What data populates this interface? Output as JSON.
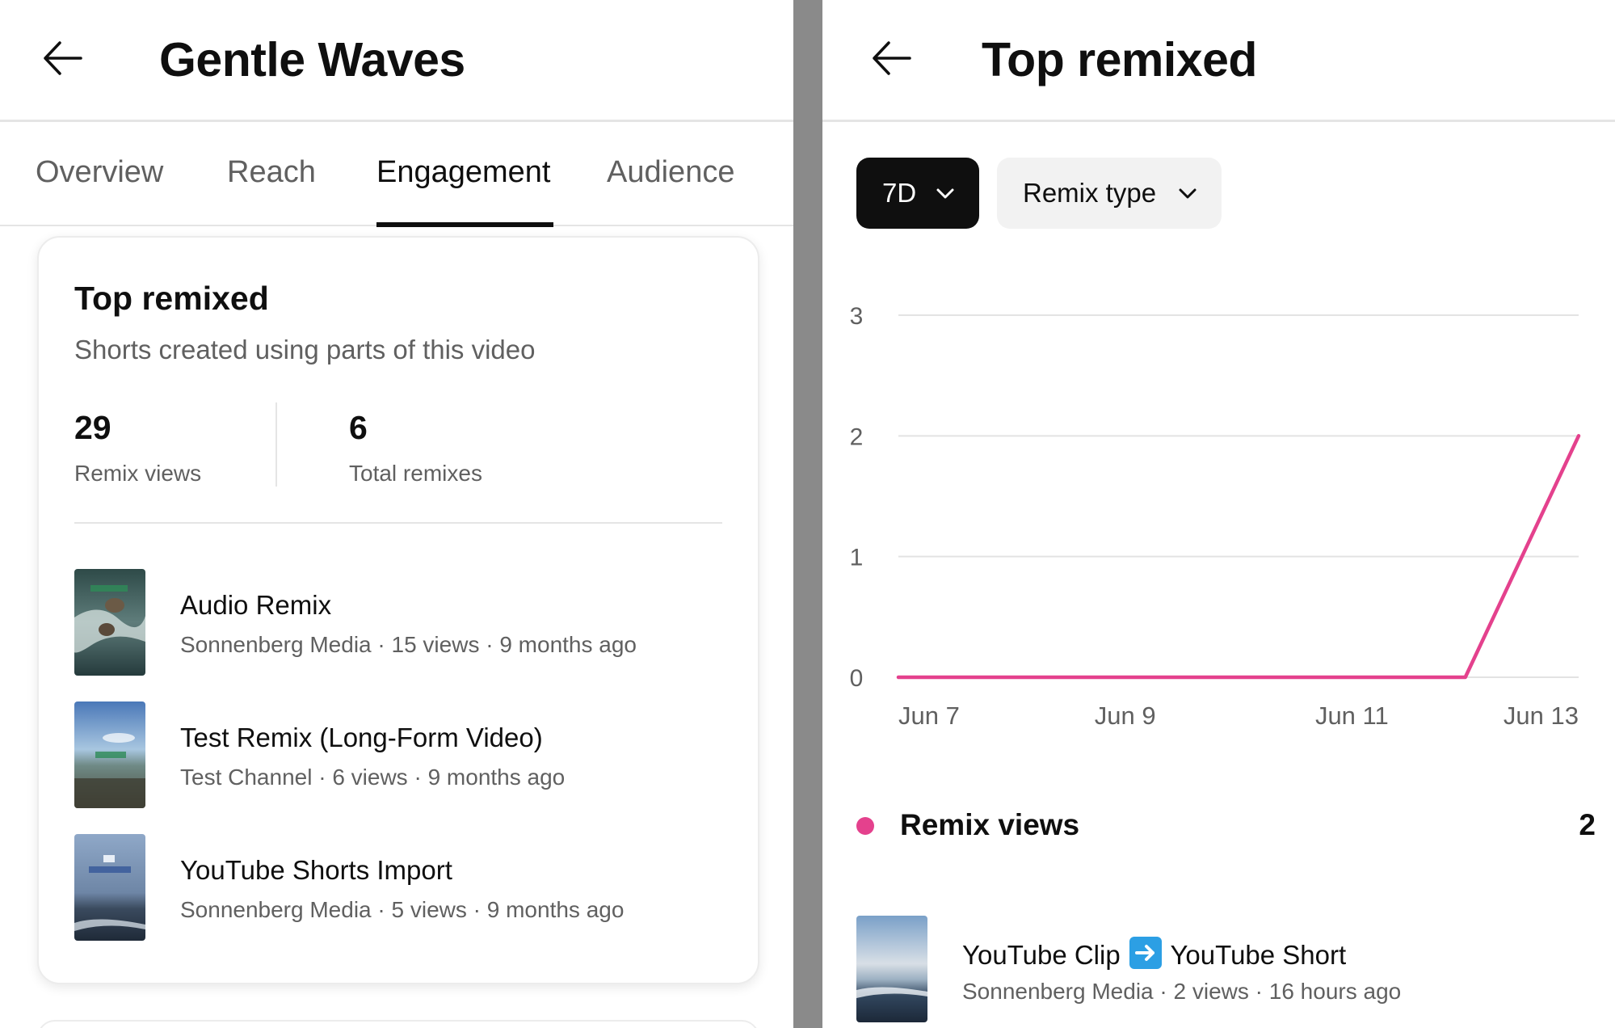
{
  "left": {
    "header": {
      "title": "Gentle Waves"
    },
    "tabs": [
      {
        "label": "Overview"
      },
      {
        "label": "Reach"
      },
      {
        "label": "Engagement"
      },
      {
        "label": "Audience"
      }
    ],
    "active_tab": "Engagement",
    "card": {
      "title": "Top remixed",
      "subtitle": "Shorts created using parts of this video",
      "metrics": [
        {
          "value": "29",
          "label": "Remix views"
        },
        {
          "value": "6",
          "label": "Total remixes"
        }
      ],
      "items": [
        {
          "title": "Audio Remix",
          "meta": "Sonnenberg Media · 15 views · 9 months ago"
        },
        {
          "title": "Test Remix (Long-Form Video)",
          "meta": "Test Channel · 6 views · 9 months ago"
        },
        {
          "title": "YouTube Shorts Import",
          "meta": "Sonnenberg Media · 5 views · 9 months ago"
        }
      ]
    }
  },
  "right": {
    "header": {
      "title": "Top remixed"
    },
    "filters": {
      "range": {
        "label": "7D"
      },
      "remix_type": {
        "label": "Remix type"
      }
    },
    "legend": {
      "name": "Remix views",
      "total": "2"
    },
    "item": {
      "title_before": "YouTube Clip",
      "title_after": "YouTube Short",
      "arrow_icon": "right-arrow-emoji-icon",
      "meta": "Sonnenberg Media · 2 views · 16 hours ago"
    }
  },
  "colors": {
    "accent": "#e4418d",
    "primary_text": "#0f0f0f",
    "secondary_text": "#606060",
    "divider": "#8a8a8a"
  },
  "chart_data": {
    "type": "line",
    "x": [
      "Jun 7",
      "Jun 8",
      "Jun 9",
      "Jun 10",
      "Jun 11",
      "Jun 12",
      "Jun 13"
    ],
    "x_tick_labels": [
      "Jun 7",
      "Jun 9",
      "Jun 11",
      "Jun 13"
    ],
    "series": [
      {
        "name": "Remix views",
        "color": "#e4418d",
        "values": [
          0,
          0,
          0,
          0,
          0,
          0,
          2
        ]
      }
    ],
    "y_ticks": [
      0,
      1,
      2,
      3
    ],
    "ylim": [
      0,
      3
    ],
    "grid": true,
    "legend": "below"
  }
}
